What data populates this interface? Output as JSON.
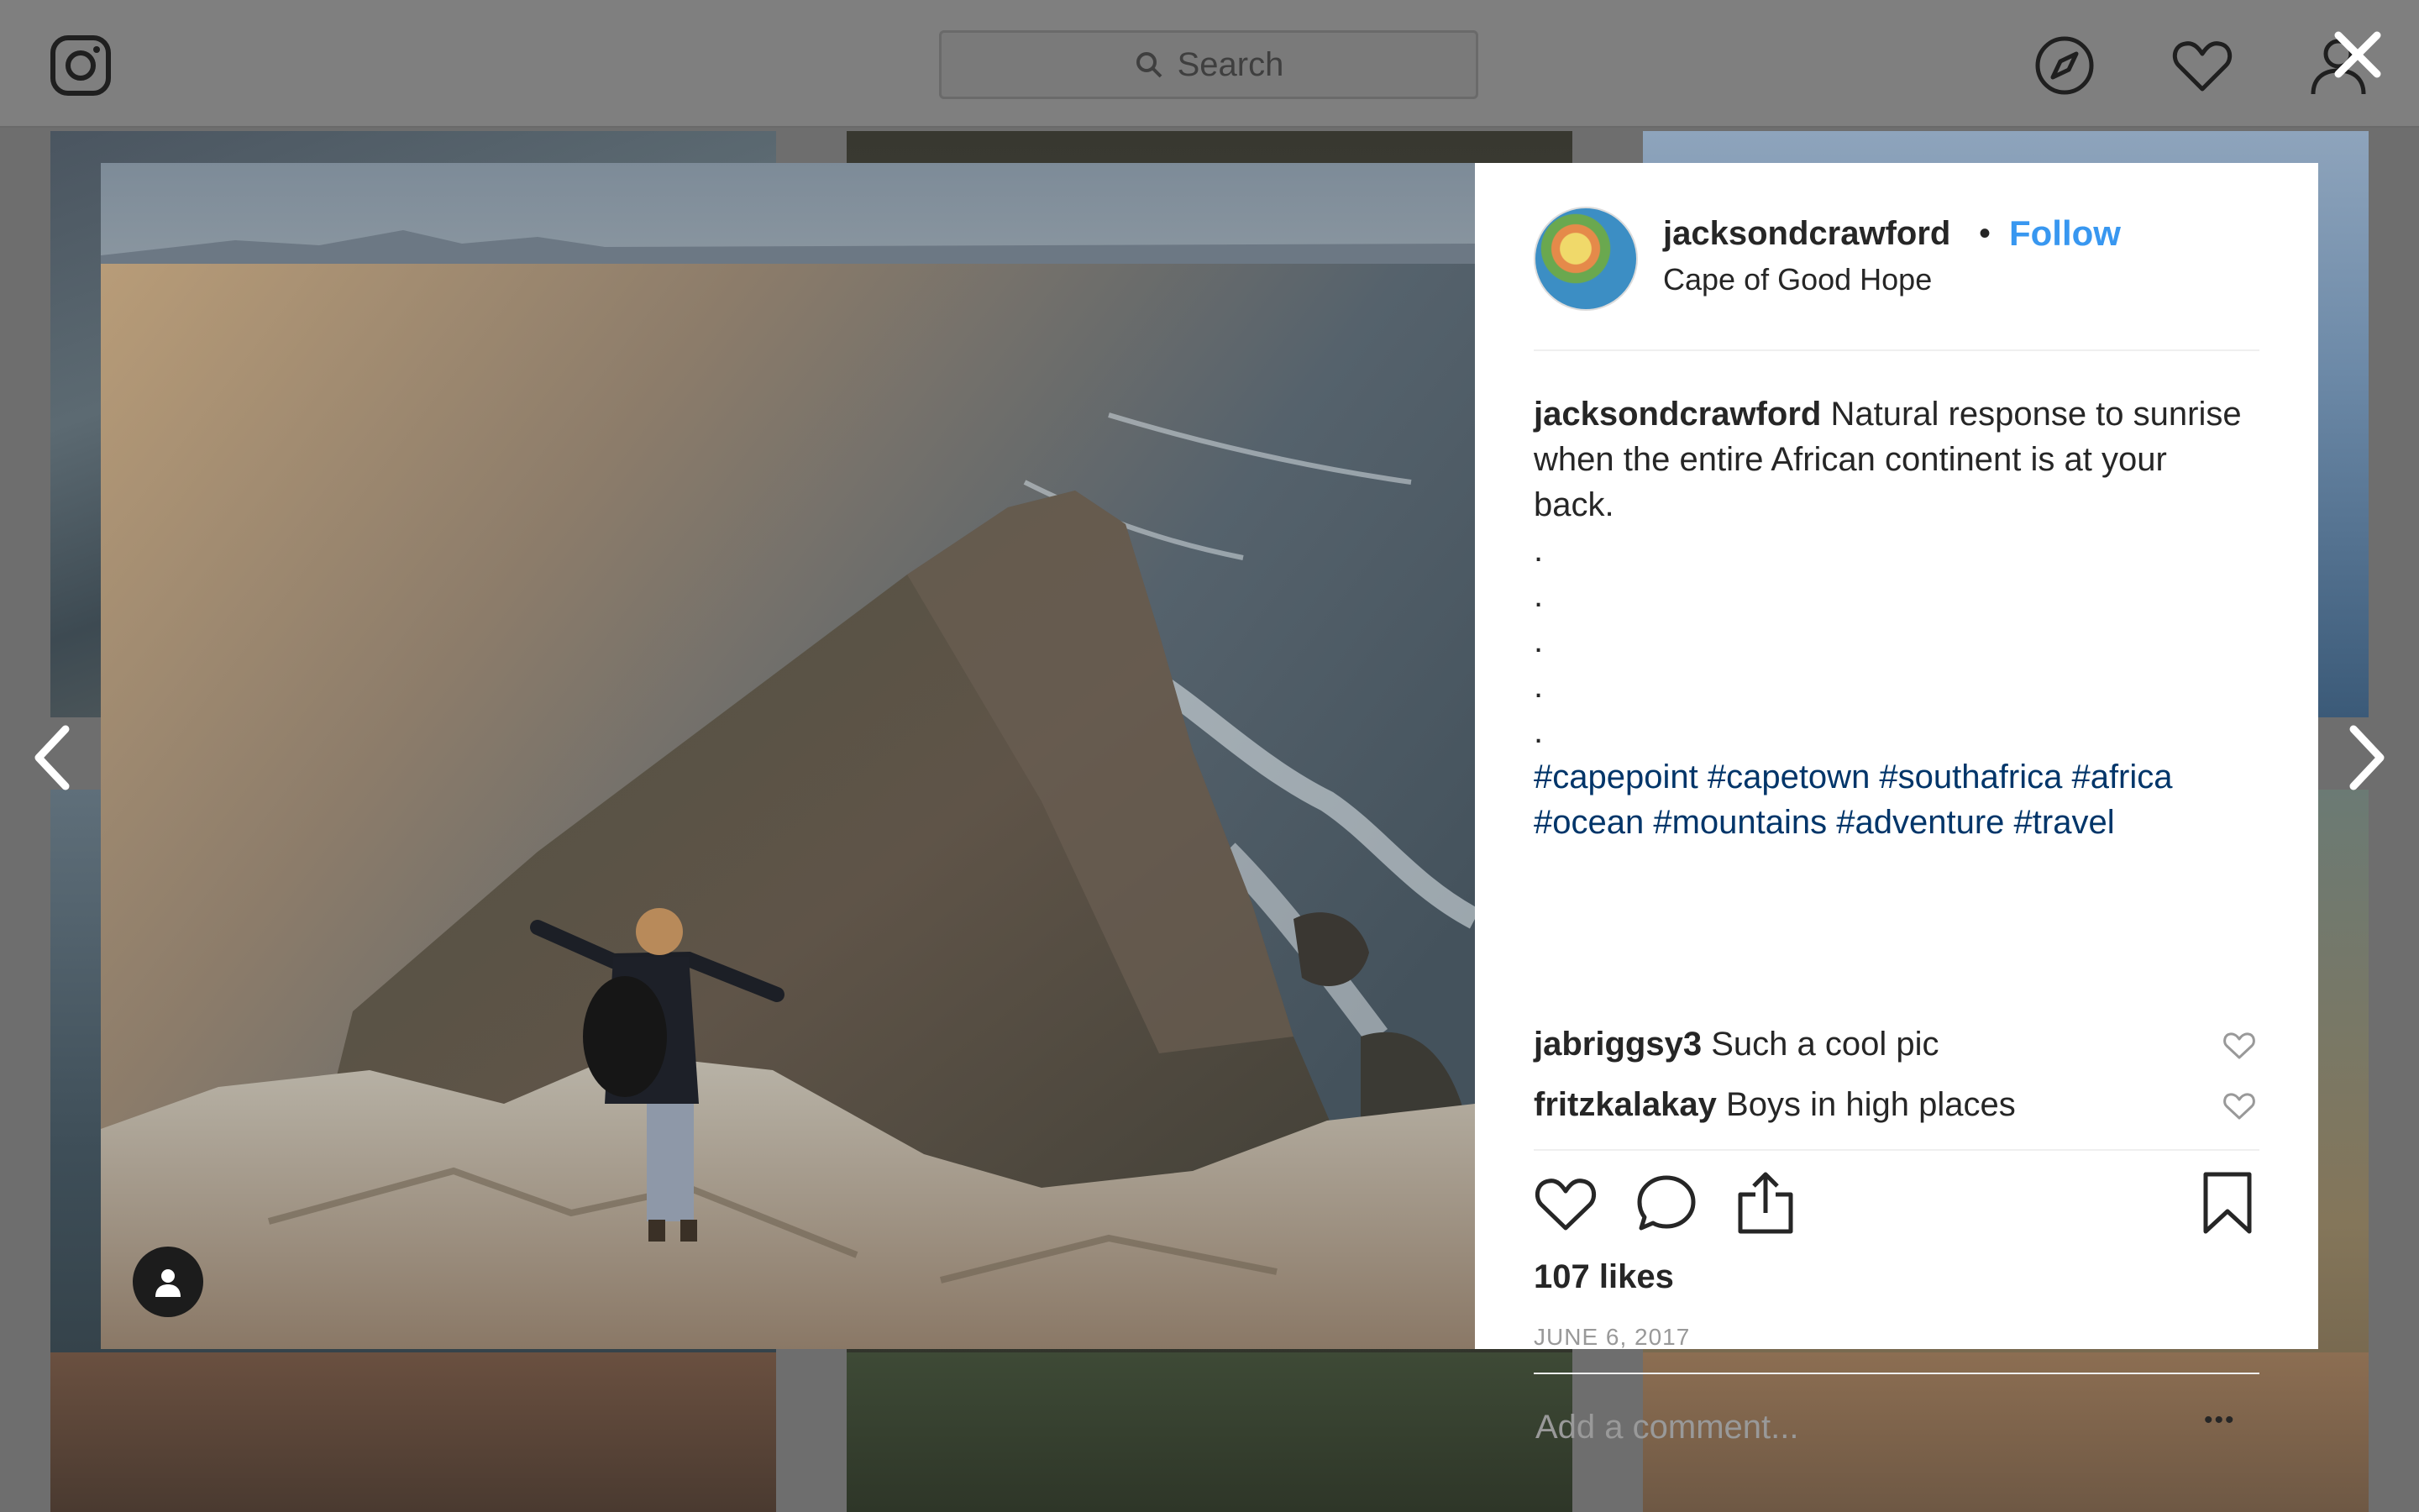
{
  "topbar": {
    "search_placeholder": "Search"
  },
  "post": {
    "username": "jacksondcrawford",
    "follow_label": "Follow",
    "separator": "•",
    "location": "Cape of Good Hope",
    "caption_username": "jacksondcrawford",
    "caption_text": "Natural response to sunrise when the entire African continent is at your back.",
    "caption_dots": [
      ".",
      ".",
      ".",
      ".",
      "."
    ],
    "hashtags": "#capepoint #capetown #southafrica #africa #ocean #mountains #adventure #travel",
    "comments": [
      {
        "username": "jabriggsy3",
        "text": "Such a cool pic"
      },
      {
        "username": "fritzkalakay",
        "text": "Boys in high places"
      }
    ],
    "likes": "107 likes",
    "date": "JUNE 6, 2017",
    "comment_placeholder": "Add a comment...",
    "more_options": "•••"
  },
  "icons": {
    "logo": "instagram-icon",
    "explore": "compass-icon",
    "activity": "heart-icon",
    "profile": "user-icon",
    "close": "close-icon",
    "prev": "chevron-left-icon",
    "next": "chevron-right-icon",
    "tag": "user-tag-icon",
    "like": "heart-icon",
    "comment": "comment-icon",
    "share": "share-icon",
    "save": "bookmark-icon"
  },
  "colors": {
    "link_blue": "#3897f0",
    "hashtag": "#003569",
    "overlay": "#6e6e6e",
    "muted": "#999999"
  }
}
